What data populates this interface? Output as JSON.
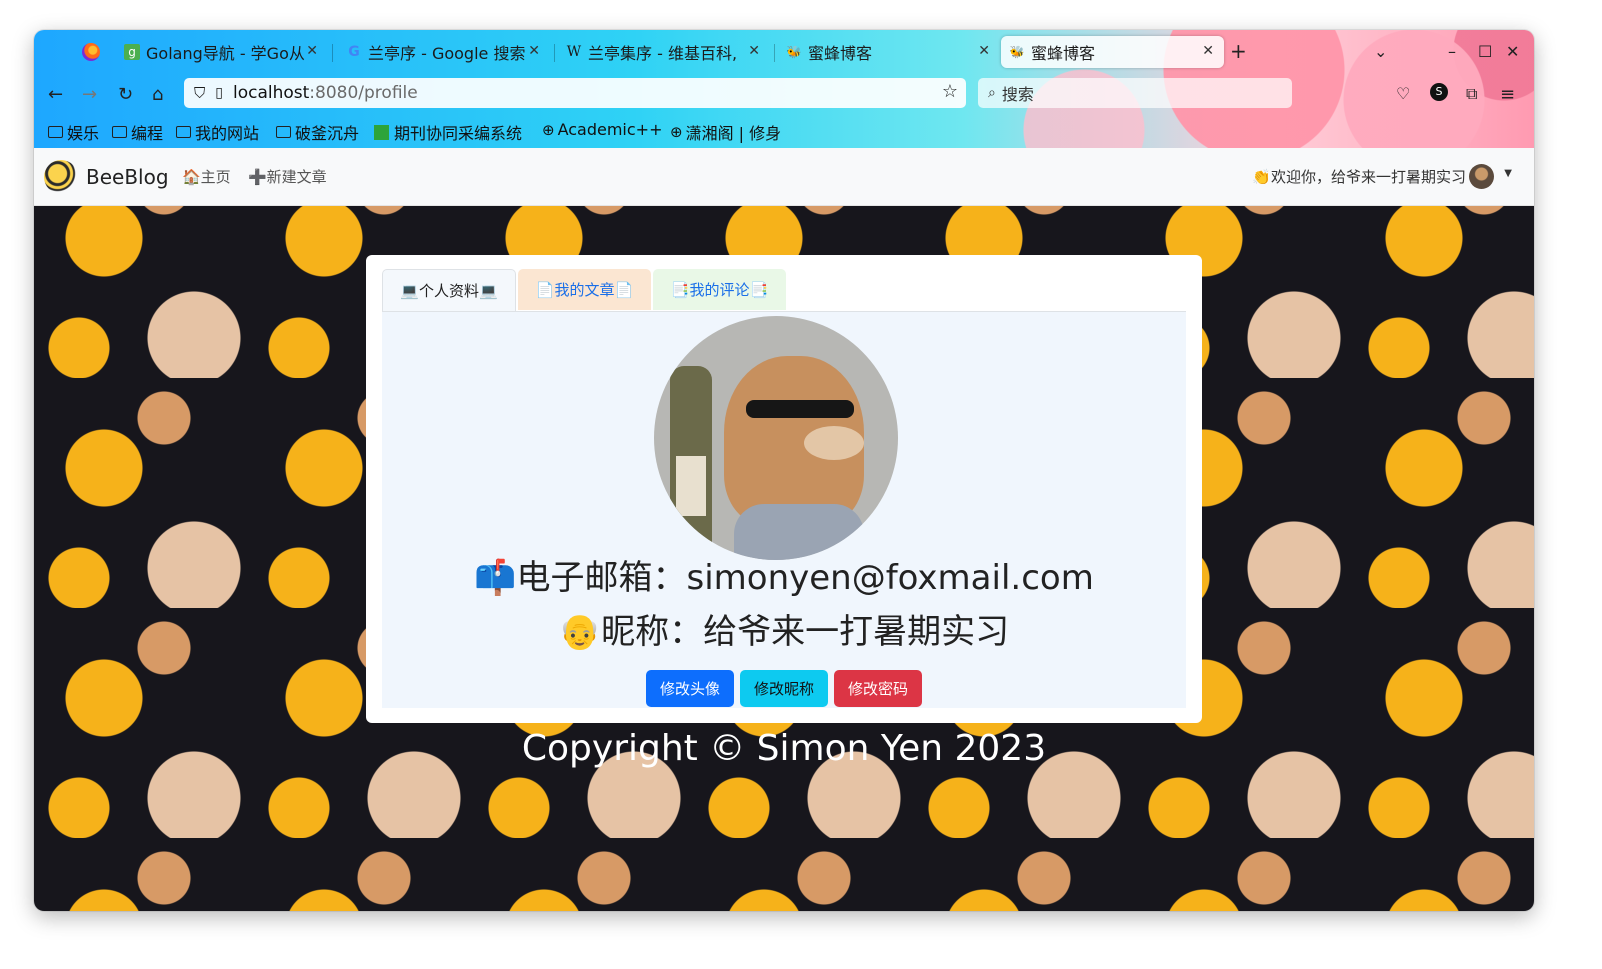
{
  "browser": {
    "tabs": [
      {
        "title": "Golang导航 - 学Go从",
        "active": false
      },
      {
        "title": "兰亭序 - Google 搜索",
        "active": false
      },
      {
        "title": "兰亭集序 - 维基百科,",
        "active": false
      },
      {
        "title": "蜜蜂博客",
        "active": false
      },
      {
        "title": "蜜蜂博客",
        "active": true
      }
    ],
    "url_host": "localhost",
    "url_path": ":8080/profile",
    "search_placeholder": "搜索",
    "bookmarks": [
      {
        "label": "娱乐",
        "icon": "folder-icon"
      },
      {
        "label": "编程",
        "icon": "folder-icon"
      },
      {
        "label": "我的网站",
        "icon": "folder-icon"
      },
      {
        "label": "破釜沉舟",
        "icon": "folder-icon"
      },
      {
        "label": "期刊协同采编系统",
        "icon": "site-icon"
      },
      {
        "label": "Academic++",
        "icon": "globe-icon"
      },
      {
        "label": "潇湘阁 | 修身",
        "icon": "globe-icon"
      }
    ]
  },
  "navbar": {
    "brand": "BeeBlog",
    "home": "🏠主页",
    "new_post": "➕新建文章",
    "welcome": "👏欢迎你，给爷来一打暑期实习"
  },
  "profile": {
    "tabs": {
      "info": "💻个人资料💻",
      "articles": "📄我的文章📄",
      "comments": "📑我的评论📑"
    },
    "email_line": "📫电子邮箱：simonyen@foxmail.com",
    "nickname_line": "👴昵称：给爷来一打暑期实习",
    "buttons": {
      "avatar": "修改头像",
      "nickname": "修改昵称",
      "password": "修改密码"
    }
  },
  "footer": "Copyright © Simon Yen 2023",
  "colors": {
    "primary": "#0d6efd",
    "info": "#0dcaf0",
    "danger": "#dc3545",
    "page_bg": "#17161c",
    "flower": "#f6b21a"
  }
}
